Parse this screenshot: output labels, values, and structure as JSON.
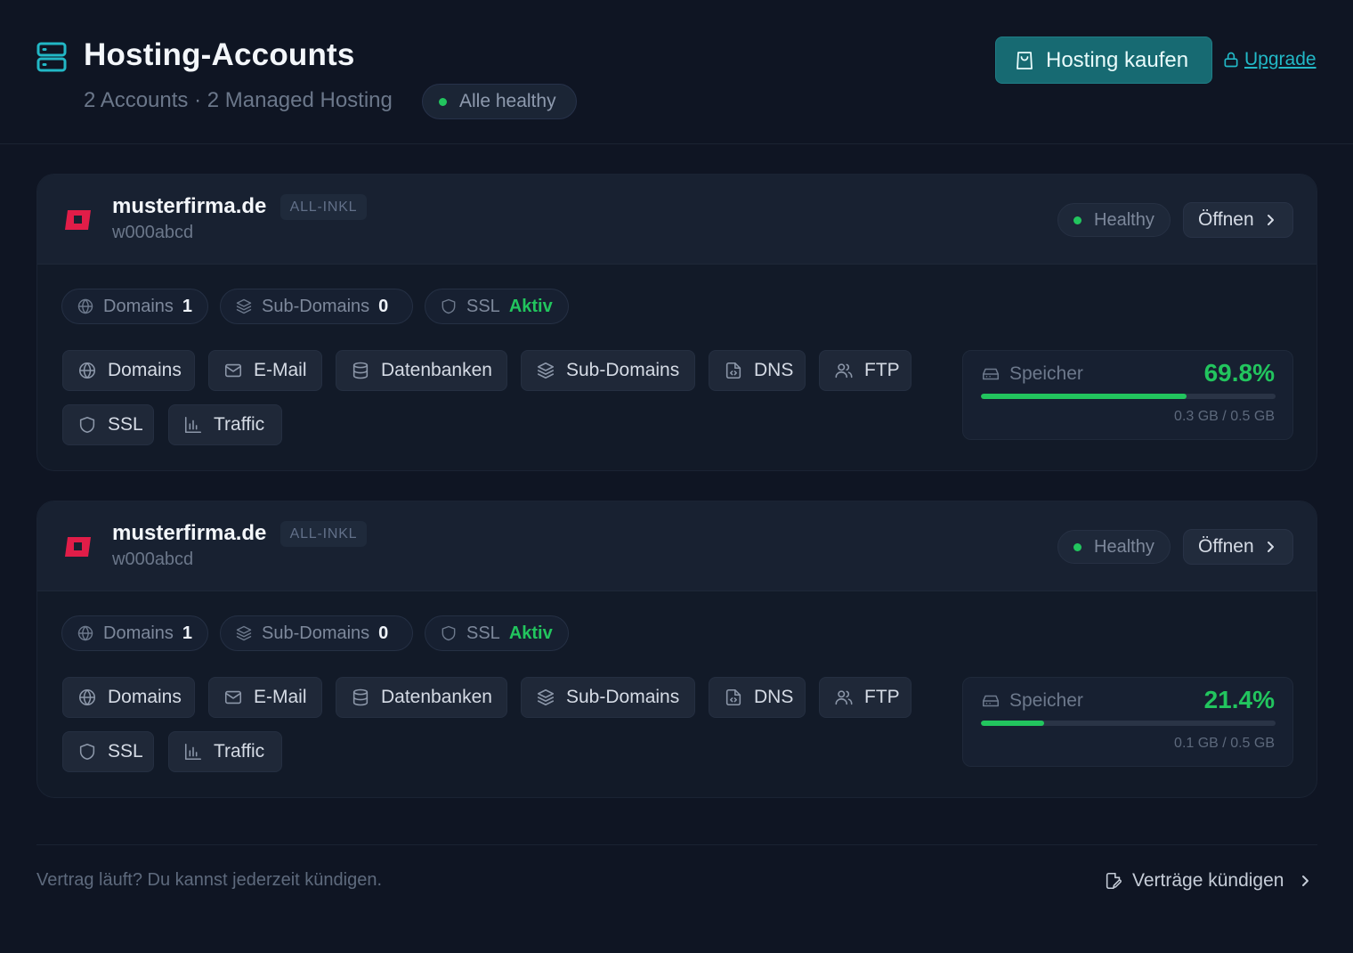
{
  "header": {
    "title": "Hosting-Accounts",
    "subtitle": "2 Accounts · 2 Managed Hosting",
    "health_status": "Alle healthy",
    "buy_button": "Hosting kaufen",
    "upgrade_link": "Upgrade",
    "accent_color": "#176a72"
  },
  "accounts": [
    {
      "domain": "musterfirma.de",
      "provider": "ALL-INKL",
      "account_id": "w000abcd",
      "status": "Healthy",
      "open_button": "Öffnen",
      "stats": [
        {
          "label": "Domains",
          "value": "1",
          "icon": "globe-icon"
        },
        {
          "label": "Sub-Domains",
          "value": "0",
          "icon": "layers-icon"
        },
        {
          "label": "SSL",
          "value": "Aktiv",
          "icon": "shield-icon"
        }
      ],
      "tools": [
        {
          "label": "Domains",
          "icon": "globe-icon"
        },
        {
          "label": "E-Mail",
          "icon": "mail-icon"
        },
        {
          "label": "Datenbanken",
          "icon": "database-icon"
        },
        {
          "label": "Sub-Domains",
          "icon": "layers-icon"
        },
        {
          "label": "DNS",
          "icon": "dns-file-icon"
        },
        {
          "label": "FTP",
          "icon": "users-icon"
        },
        {
          "label": "SSL",
          "icon": "shield-icon"
        },
        {
          "label": "Traffic",
          "icon": "bar-chart-icon"
        }
      ],
      "storage": {
        "label": "Speicher",
        "percent_text": "69.8%",
        "fraction": 0.698,
        "usage_text": "0.3 GB / 0.5 GB"
      }
    },
    {
      "domain": "musterfirma.de",
      "provider": "ALL-INKL",
      "account_id": "w000abcd",
      "status": "Healthy",
      "open_button": "Öffnen",
      "stats": [
        {
          "label": "Domains",
          "value": "1",
          "icon": "globe-icon"
        },
        {
          "label": "Sub-Domains",
          "value": "0",
          "icon": "layers-icon"
        },
        {
          "label": "SSL",
          "value": "Aktiv",
          "icon": "shield-icon"
        }
      ],
      "tools": [
        {
          "label": "Domains",
          "icon": "globe-icon"
        },
        {
          "label": "E-Mail",
          "icon": "mail-icon"
        },
        {
          "label": "Datenbanken",
          "icon": "database-icon"
        },
        {
          "label": "Sub-Domains",
          "icon": "layers-icon"
        },
        {
          "label": "DNS",
          "icon": "dns-file-icon"
        },
        {
          "label": "FTP",
          "icon": "users-icon"
        },
        {
          "label": "SSL",
          "icon": "shield-icon"
        },
        {
          "label": "Traffic",
          "icon": "bar-chart-icon"
        }
      ],
      "storage": {
        "label": "Speicher",
        "percent_text": "21.4%",
        "fraction": 0.214,
        "usage_text": "0.1 GB / 0.5 GB"
      }
    }
  ],
  "footer": {
    "note": "Vertrag läuft? Du kannst jederzeit kündigen.",
    "cancel_link": "Verträge kündigen"
  },
  "colors": {
    "healthy": "#22c55e",
    "provider_logo": "#e11d48"
  }
}
